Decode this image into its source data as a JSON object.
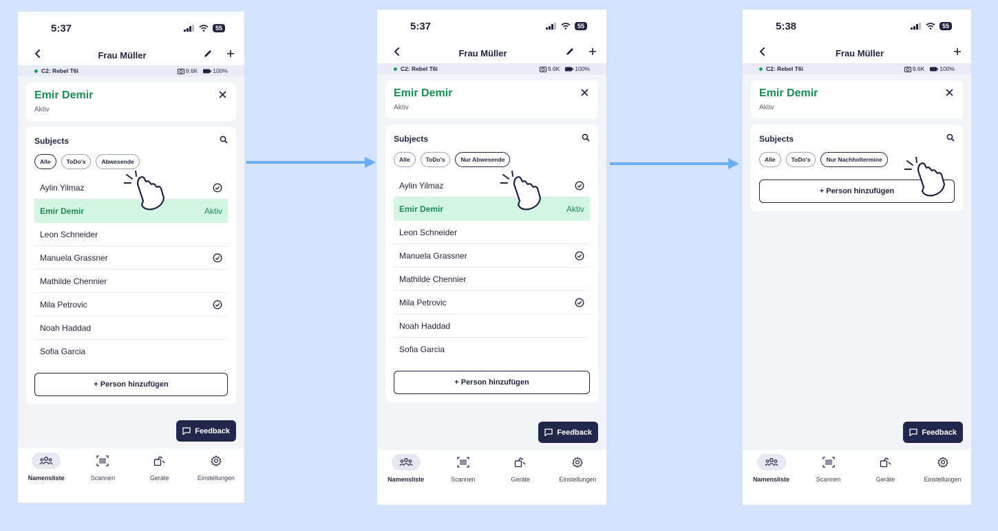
{
  "colors": {
    "background": "#d3e3fb",
    "accent_green": "#1c8a52",
    "active_row": "#d3f5e3",
    "dark": "#1f2340",
    "arrow": "#6aaef5"
  },
  "screens": [
    {
      "time": "5:37",
      "battery": "55",
      "nav_title": "Frau Müller",
      "show_edit": true,
      "device_label": "C2: Rebel T6i",
      "shots": "9.6K",
      "battery_pct": "100%",
      "active_name": "Emir Demir",
      "active_status": "Aktiv",
      "subjects_title": "Subjects",
      "chips": [
        "Alle",
        "ToDo's",
        "Abwesende"
      ],
      "selected_chip": 0,
      "people": [
        {
          "name": "Aylin Yilmaz",
          "check": true,
          "badge": ""
        },
        {
          "name": "Emir Demir",
          "check": false,
          "badge": "Aktiv"
        },
        {
          "name": "Leon Schneider",
          "check": false,
          "badge": ""
        },
        {
          "name": "Manuela Grassner",
          "check": true,
          "badge": ""
        },
        {
          "name": "Mathilde Chennier",
          "check": false,
          "badge": ""
        },
        {
          "name": "Mila Petrovic",
          "check": true,
          "badge": ""
        },
        {
          "name": "Noah Haddad",
          "check": false,
          "badge": ""
        },
        {
          "name": "Sofia Garcia",
          "check": false,
          "badge": ""
        }
      ],
      "add_label": "+ Person hinzufügen",
      "feedback_label": "Feedback"
    },
    {
      "time": "5:37",
      "battery": "55",
      "nav_title": "Frau Müller",
      "show_edit": true,
      "device_label": "C2: Rebel T6i",
      "shots": "9.6K",
      "battery_pct": "100%",
      "active_name": "Emir Demir",
      "active_status": "Aktiv",
      "subjects_title": "Subjects",
      "chips": [
        "Alle",
        "ToDo's",
        "Nur Abwesende"
      ],
      "selected_chip": 2,
      "people": [
        {
          "name": "Aylin Yilmaz",
          "check": true,
          "badge": ""
        },
        {
          "name": "Emir Demir",
          "check": false,
          "badge": "Aktiv"
        },
        {
          "name": "Leon Schneider",
          "check": false,
          "badge": ""
        },
        {
          "name": "Manuela Grassner",
          "check": true,
          "badge": ""
        },
        {
          "name": "Mathilde Chennier",
          "check": false,
          "badge": ""
        },
        {
          "name": "Mila Petrovic",
          "check": true,
          "badge": ""
        },
        {
          "name": "Noah Haddad",
          "check": false,
          "badge": ""
        },
        {
          "name": "Sofia Garcia",
          "check": false,
          "badge": ""
        }
      ],
      "add_label": "+ Person hinzufügen",
      "feedback_label": "Feedback"
    },
    {
      "time": "5:38",
      "battery": "55",
      "nav_title": "Frau Müller",
      "show_edit": false,
      "device_label": "C2: Rebel T6i",
      "shots": "9.6K",
      "battery_pct": "100%",
      "active_name": "Emir Demir",
      "active_status": "Aktiv",
      "subjects_title": "Subjects",
      "chips": [
        "Alle",
        "ToDo's",
        "Nur Nachholtermine"
      ],
      "selected_chip": 2,
      "people": [],
      "add_label": "+ Person hinzufügen",
      "feedback_label": "Feedback"
    }
  ],
  "tabs": [
    {
      "label": "Namensliste",
      "icon": "people-icon",
      "selected": true
    },
    {
      "label": "Scannen",
      "icon": "barcode-scan-icon",
      "selected": false
    },
    {
      "label": "Geräte",
      "icon": "devices-icon",
      "selected": false
    },
    {
      "label": "Einstellungen",
      "icon": "gear-icon",
      "selected": false
    }
  ]
}
